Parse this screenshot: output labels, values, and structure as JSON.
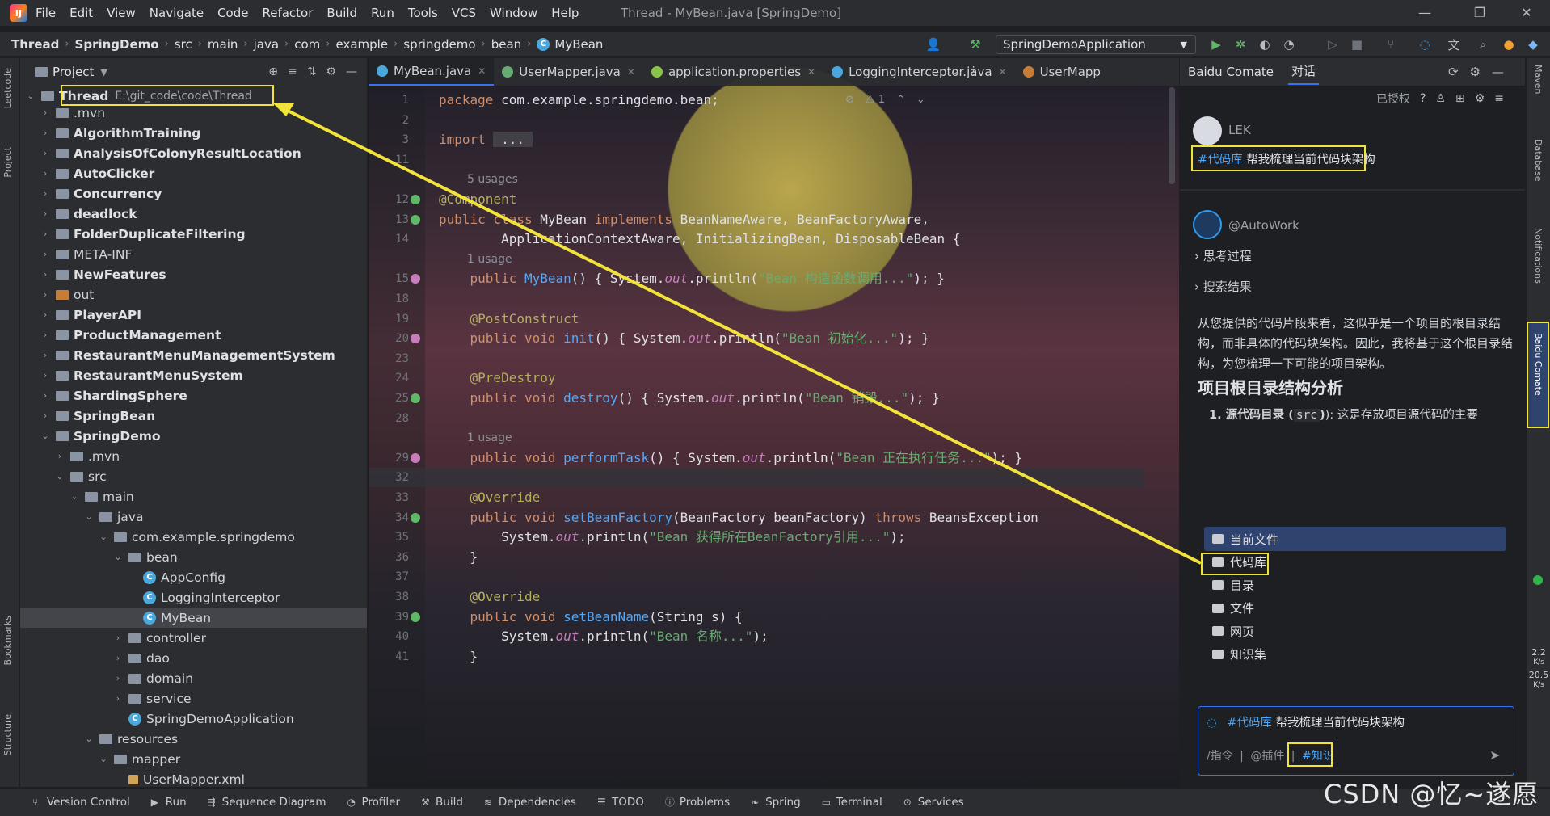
{
  "window": {
    "title": "Thread - MyBean.java [SpringDemo]"
  },
  "menu": [
    "File",
    "Edit",
    "View",
    "Navigate",
    "Code",
    "Refactor",
    "Build",
    "Run",
    "Tools",
    "VCS",
    "Window",
    "Help"
  ],
  "breadcrumb": [
    "Thread",
    "SpringDemo",
    "src",
    "main",
    "java",
    "com",
    "example",
    "springdemo",
    "bean",
    "MyBean"
  ],
  "toolbar": {
    "run_config": "SpringDemoApplication"
  },
  "side_tabs": {
    "left_top": [
      "Leetcode",
      "Project"
    ],
    "left_bottom": [
      "Bookmarks",
      "Structure"
    ],
    "right": [
      "Maven",
      "Database",
      "Notifications",
      "Baidu Comate"
    ]
  },
  "project": {
    "title": "Project",
    "root_name": "Thread",
    "root_path": "E:\\git_code\\code\\Thread",
    "items": [
      {
        "label": ".mvn",
        "depth": 1,
        "kind": "folder",
        "open": false,
        "bold": false
      },
      {
        "label": "AlgorithmTraining",
        "depth": 1,
        "kind": "module",
        "open": false,
        "bold": true
      },
      {
        "label": "AnalysisOfColonyResultLocation",
        "depth": 1,
        "kind": "module",
        "open": false,
        "bold": true
      },
      {
        "label": "AutoClicker",
        "depth": 1,
        "kind": "module",
        "open": false,
        "bold": true
      },
      {
        "label": "Concurrency",
        "depth": 1,
        "kind": "module",
        "open": false,
        "bold": true
      },
      {
        "label": "deadlock",
        "depth": 1,
        "kind": "module",
        "open": false,
        "bold": true
      },
      {
        "label": "FolderDuplicateFiltering",
        "depth": 1,
        "kind": "module",
        "open": false,
        "bold": true
      },
      {
        "label": "META-INF",
        "depth": 1,
        "kind": "folder",
        "open": false,
        "bold": false
      },
      {
        "label": "NewFeatures",
        "depth": 1,
        "kind": "module",
        "open": false,
        "bold": true
      },
      {
        "label": "out",
        "depth": 1,
        "kind": "folder-orange",
        "open": false,
        "bold": false
      },
      {
        "label": "PlayerAPI",
        "depth": 1,
        "kind": "module",
        "open": false,
        "bold": true
      },
      {
        "label": "ProductManagement",
        "depth": 1,
        "kind": "module",
        "open": false,
        "bold": true
      },
      {
        "label": "RestaurantMenuManagementSystem",
        "depth": 1,
        "kind": "module",
        "open": false,
        "bold": true
      },
      {
        "label": "RestaurantMenuSystem",
        "depth": 1,
        "kind": "module",
        "open": false,
        "bold": true
      },
      {
        "label": "ShardingSphere",
        "depth": 1,
        "kind": "module",
        "open": false,
        "bold": true
      },
      {
        "label": "SpringBean",
        "depth": 1,
        "kind": "module",
        "open": false,
        "bold": true
      },
      {
        "label": "SpringDemo",
        "depth": 1,
        "kind": "module",
        "open": true,
        "bold": true
      },
      {
        "label": ".mvn",
        "depth": 2,
        "kind": "folder",
        "open": false,
        "bold": false
      },
      {
        "label": "src",
        "depth": 2,
        "kind": "folder",
        "open": true,
        "bold": false
      },
      {
        "label": "main",
        "depth": 3,
        "kind": "folder",
        "open": true,
        "bold": false
      },
      {
        "label": "java",
        "depth": 4,
        "kind": "folder",
        "open": true,
        "bold": false
      },
      {
        "label": "com.example.springdemo",
        "depth": 5,
        "kind": "folder",
        "open": true,
        "bold": false
      },
      {
        "label": "bean",
        "depth": 6,
        "kind": "folder",
        "open": true,
        "bold": false
      },
      {
        "label": "AppConfig",
        "depth": 7,
        "kind": "class",
        "open": null,
        "bold": false
      },
      {
        "label": "LoggingInterceptor",
        "depth": 7,
        "kind": "class",
        "open": null,
        "bold": false
      },
      {
        "label": "MyBean",
        "depth": 7,
        "kind": "class",
        "open": null,
        "bold": false,
        "selected": true
      },
      {
        "label": "controller",
        "depth": 6,
        "kind": "folder",
        "open": false,
        "bold": false
      },
      {
        "label": "dao",
        "depth": 6,
        "kind": "folder",
        "open": false,
        "bold": false
      },
      {
        "label": "domain",
        "depth": 6,
        "kind": "folder",
        "open": false,
        "bold": false
      },
      {
        "label": "service",
        "depth": 6,
        "kind": "folder",
        "open": false,
        "bold": false
      },
      {
        "label": "SpringDemoApplication",
        "depth": 6,
        "kind": "class",
        "open": null,
        "bold": false
      },
      {
        "label": "resources",
        "depth": 4,
        "kind": "folder",
        "open": true,
        "bold": false
      },
      {
        "label": "mapper",
        "depth": 5,
        "kind": "folder",
        "open": true,
        "bold": false
      },
      {
        "label": "UserMapper.xml",
        "depth": 6,
        "kind": "file",
        "open": null,
        "bold": false
      }
    ]
  },
  "editor": {
    "tabs": [
      {
        "label": "MyBean.java",
        "active": true,
        "color": "#4aa8dd"
      },
      {
        "label": "UserMapper.java",
        "active": false,
        "color": "#6aab73"
      },
      {
        "label": "application.properties",
        "active": false,
        "color": "#8bc34a"
      },
      {
        "label": "LoggingInterceptor.java",
        "active": false,
        "color": "#4aa8dd"
      },
      {
        "label": "UserMapp",
        "active": false,
        "color": "#c77d3a"
      }
    ],
    "inspection": "1",
    "lines": [
      {
        "n": "1",
        "segs": [
          [
            "kw",
            "package "
          ],
          [
            "ty",
            "com.example.springdemo.bean;"
          ]
        ]
      },
      {
        "n": "2",
        "segs": []
      },
      {
        "n": "3",
        "segs": [
          [
            "kw",
            "import "
          ],
          [
            "fold",
            " ... "
          ]
        ]
      },
      {
        "n": "11",
        "segs": []
      },
      {
        "n": "",
        "hint": "5 usages"
      },
      {
        "n": "12",
        "segs": [
          [
            "an",
            "@Component"
          ]
        ]
      },
      {
        "n": "13",
        "segs": [
          [
            "kw",
            "public class "
          ],
          [
            "ty",
            "MyBean "
          ],
          [
            "kw",
            "implements "
          ],
          [
            "ty",
            "BeanNameAware, BeanFactoryAware,"
          ]
        ]
      },
      {
        "n": "14",
        "segs": [
          [
            "ty",
            "        ApplicationContextAware, InitializingBean, DisposableBean {"
          ]
        ]
      },
      {
        "n": "",
        "hint": "1 usage"
      },
      {
        "n": "15",
        "segs": [
          [
            "kw",
            "    public "
          ],
          [
            "fn",
            "MyBean"
          ],
          [
            "ty",
            "() { System."
          ],
          [
            "it",
            "out"
          ],
          [
            "ty",
            ".println("
          ],
          [
            "str",
            "\"Bean 构造函数调用...\""
          ],
          [
            "ty",
            "); }"
          ]
        ]
      },
      {
        "n": "18",
        "segs": []
      },
      {
        "n": "19",
        "segs": [
          [
            "an",
            "    @PostConstruct"
          ]
        ]
      },
      {
        "n": "20",
        "segs": [
          [
            "kw",
            "    public void "
          ],
          [
            "fn",
            "init"
          ],
          [
            "ty",
            "() { System."
          ],
          [
            "it",
            "out"
          ],
          [
            "ty",
            ".println("
          ],
          [
            "str",
            "\"Bean 初始化...\""
          ],
          [
            "ty",
            "); }"
          ]
        ]
      },
      {
        "n": "23",
        "segs": []
      },
      {
        "n": "24",
        "segs": [
          [
            "an",
            "    @PreDestroy"
          ]
        ]
      },
      {
        "n": "25",
        "segs": [
          [
            "kw",
            "    public void "
          ],
          [
            "fn",
            "destroy"
          ],
          [
            "ty",
            "() { System."
          ],
          [
            "it",
            "out"
          ],
          [
            "ty",
            ".println("
          ],
          [
            "str",
            "\"Bean 销毁...\""
          ],
          [
            "ty",
            "); }"
          ]
        ]
      },
      {
        "n": "28",
        "segs": []
      },
      {
        "n": "",
        "hint": "1 usage"
      },
      {
        "n": "29",
        "segs": [
          [
            "kw",
            "    public void "
          ],
          [
            "fn",
            "performTask"
          ],
          [
            "ty",
            "() { System."
          ],
          [
            "it",
            "out"
          ],
          [
            "ty",
            ".println("
          ],
          [
            "str",
            "\"Bean 正在执行任务...\""
          ],
          [
            "ty",
            "); }"
          ]
        ]
      },
      {
        "n": "32",
        "segs": [],
        "current": true
      },
      {
        "n": "33",
        "segs": [
          [
            "an",
            "    @Override"
          ]
        ]
      },
      {
        "n": "34",
        "segs": [
          [
            "kw",
            "    public void "
          ],
          [
            "fn",
            "setBeanFactory"
          ],
          [
            "ty",
            "(BeanFactory beanFactory) "
          ],
          [
            "kw",
            "throws "
          ],
          [
            "ty",
            "BeansException"
          ]
        ]
      },
      {
        "n": "35",
        "segs": [
          [
            "ty",
            "        System."
          ],
          [
            "it",
            "out"
          ],
          [
            "ty",
            ".println("
          ],
          [
            "str",
            "\"Bean 获得所在BeanFactory引用...\""
          ],
          [
            "ty",
            ");"
          ]
        ]
      },
      {
        "n": "36",
        "segs": [
          [
            "ty",
            "    }"
          ]
        ]
      },
      {
        "n": "37",
        "segs": []
      },
      {
        "n": "38",
        "segs": [
          [
            "an",
            "    @Override"
          ]
        ]
      },
      {
        "n": "39",
        "segs": [
          [
            "kw",
            "    public void "
          ],
          [
            "fn",
            "setBeanName"
          ],
          [
            "ty",
            "(String s) {"
          ]
        ]
      },
      {
        "n": "40",
        "segs": [
          [
            "ty",
            "        System."
          ],
          [
            "it",
            "out"
          ],
          [
            "ty",
            ".println("
          ],
          [
            "str",
            "\"Bean 名称...\""
          ],
          [
            "ty",
            ");"
          ]
        ]
      },
      {
        "n": "41",
        "segs": [
          [
            "ty",
            "    }"
          ]
        ]
      }
    ]
  },
  "comate": {
    "title": "Baidu Comate",
    "tab": "对话",
    "authorized": "已授权",
    "user_name": "LEK",
    "user_msg_chip": "#代码库",
    "user_msg_text": "帮我梳理当前代码块架构",
    "bot_name": "@AutoWork",
    "thinking": "思考过程",
    "search_results": "搜索结果",
    "answer_para": "从您提供的代码片段来看，这似乎是一个项目的根目录结构，而非具体的代码块架构。因此，我将基于这个根目录结构，为您梳理一下可能的项目架构。",
    "answer_heading": "项目根目录结构分析",
    "answer_list_1_bold": "1. 源代码目录 (",
    "answer_list_1_code": "src",
    "answer_list_1_rest": "): 这是存放项目源代码的主要",
    "dropdown": [
      "当前文件",
      "代码库",
      "目录",
      "文件",
      "网页",
      "知识集"
    ],
    "input_chip": "#代码库",
    "input_text": "帮我梳理当前代码块架构",
    "input_cmd": "/指令",
    "input_plugin": "@插件",
    "input_knowledge": "#知识",
    "net_up": "2.2",
    "net_up_unit": "K/s",
    "net_down": "20.5",
    "net_down_unit": "K/s"
  },
  "statusbar": [
    "Version Control",
    "Run",
    "Sequence Diagram",
    "Profiler",
    "Build",
    "Dependencies",
    "TODO",
    "Problems",
    "Spring",
    "Terminal",
    "Services"
  ],
  "watermark": "CSDN @忆~遂愿",
  "colors": {
    "accent": "#3574f0",
    "highlight": "#f2e33b",
    "chip": "#4aa8ff"
  }
}
